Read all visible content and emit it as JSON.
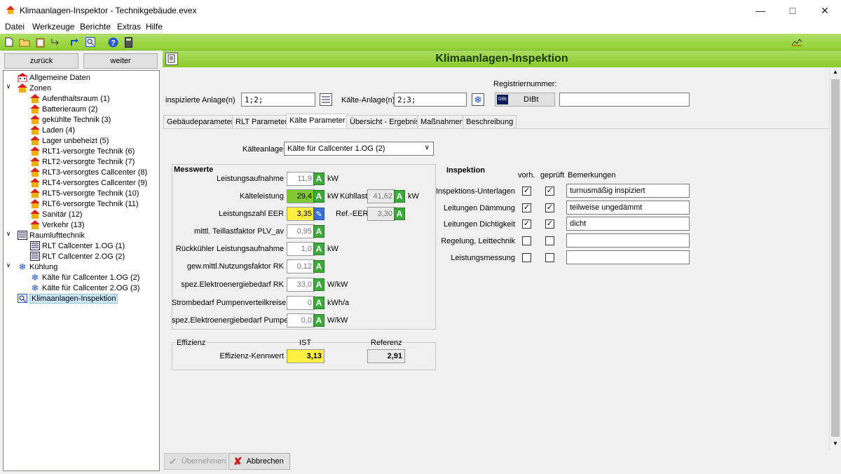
{
  "window": {
    "title": "Klimaanlagen-Inspektor - Technikgebäude.evex",
    "controls": [
      "minimize-icon",
      "maximize-icon",
      "close-icon"
    ]
  },
  "menu": [
    "Datei",
    "Werkzeuge",
    "Berichte",
    "Extras",
    "Hilfe"
  ],
  "toolbar": {
    "icons": [
      "new-file-icon",
      "open-folder-icon",
      "clipboard-icon",
      "import-icon",
      "export-icon",
      "search-icon",
      "help-icon",
      "calculator-icon"
    ],
    "chart_icon": "chart-icon"
  },
  "nav": {
    "back": "zurück",
    "forward": "weiter"
  },
  "tree": {
    "general": "Allgemeine Daten",
    "zones_label": "Zonen",
    "zones": [
      "Aufenthaltsraum (1)",
      "Batterieraum (2)",
      "gekühlte Technik (3)",
      "Laden (4)",
      "Lager unbeheizt (5)",
      "RLT1-versorgte Technik (6)",
      "RLT2-versorgte Technik (7)",
      "RLT3-versorgtes Callcenter (8)",
      "RLT4-versorgtes Callcenter (9)",
      "RLT5-versorgte Technik (10)",
      "RLT6-versorgte Technik (11)",
      "Sanitär (12)",
      "Verkehr (13)"
    ],
    "ventilation_label": "Raumlufttechnik",
    "ventilation": [
      "RLT Callcenter 1.OG (1)",
      "RLT Callcenter 2.OG (2)"
    ],
    "cooling_label": "Kühlung",
    "cooling": [
      "Kälte für Callcenter 1.OG (2)",
      "Kälte für Callcenter 2.OG (3)"
    ],
    "inspection": "Klimaanlagen-Inspektion"
  },
  "header": {
    "title": "Klimaanlagen-Inspektion"
  },
  "top": {
    "inspected_label": "inspizierte Anlage(n)",
    "inspected_value": "1;2;",
    "cooling_label": "Kälte-Anlage(n)",
    "cooling_value": "2;3;",
    "reg_label": "Registriernummer:",
    "dibt_label": "DIBt",
    "dibt_logo": "DIBt",
    "reg_value": ""
  },
  "tabs": [
    "Gebäudeparameter",
    "RLT Parameter",
    "Kälte Parameter",
    "Übersicht - Ergebnis",
    "Maßnahmen",
    "Beschreibung"
  ],
  "active_tab": "Kälte Parameter",
  "kaelteanlage": {
    "label": "Kälteanlage",
    "value": "Kälte für Callcenter 1.OG (2)"
  },
  "messwerte": {
    "title": "Messwerte",
    "rows": [
      {
        "label": "Leistungsaufnahme",
        "value": "11,9",
        "unit": "kW",
        "badge": "A",
        "style": ""
      },
      {
        "label": "Kälteleistung",
        "value": "29,4",
        "unit": "kW",
        "badge": "A",
        "style": "green"
      },
      {
        "label": "Leistungszahl EER",
        "value": "3,35",
        "unit": "",
        "badge": "edit",
        "style": "yellow"
      },
      {
        "label": "mittl. Teillastfaktor PLV_av",
        "value": "0,95",
        "unit": "",
        "badge": "A",
        "style": ""
      },
      {
        "label": "Rückkühler Leistungsaufnahme",
        "value": "1,0",
        "unit": "kW",
        "badge": "A",
        "style": ""
      },
      {
        "label": "gew.mittl.Nutzungsfaktor RK",
        "value": "0,12",
        "unit": "",
        "badge": "A",
        "style": ""
      },
      {
        "label": "spez.Elektroenergiebedarf RK",
        "value": "33,0",
        "unit": "W/kW",
        "badge": "A",
        "style": ""
      },
      {
        "label": "Strombedarf Pumpenverteilkreise",
        "value": "0",
        "unit": "kWh/a",
        "badge": "A",
        "style": ""
      },
      {
        "label": "spez.Elektroenergiebedarf Pumpen",
        "value": "0,0",
        "unit": "W/kW",
        "badge": "A",
        "style": ""
      }
    ],
    "kuehllast": {
      "label": "Kühllast",
      "value": "41,62",
      "unit": "kW",
      "badge": "A"
    },
    "ref_eer": {
      "label": "Ref.-EER",
      "value": "3,30",
      "badge": "A"
    },
    "badge_letter": "A",
    "edit_glyph": "✎"
  },
  "effizienz": {
    "title": "Effizienz",
    "ist_label": "IST",
    "ref_label": "Referenz",
    "row_label": "Effizienz-Kennwert",
    "ist_value": "3,13",
    "ref_value": "2,91"
  },
  "inspektion": {
    "title": "Inspektion",
    "col_vorh": "vorh.",
    "col_geprueft": "geprüft",
    "col_remarks": "Bemerkungen",
    "rows": [
      {
        "label": "Inspektions-Unterlagen",
        "vorh": true,
        "geprueft": true,
        "remark": "turnusmäßig inspiziert"
      },
      {
        "label": "Leitungen Dämmung",
        "vorh": true,
        "geprueft": true,
        "remark": "teilweise ungedämmt"
      },
      {
        "label": "Leitungen Dichtigkeit",
        "vorh": true,
        "geprueft": true,
        "remark": "dicht"
      },
      {
        "label": "Regelung, Leittechnik",
        "vorh": false,
        "geprueft": false,
        "remark": ""
      },
      {
        "label": "Leistungsmessung",
        "vorh": false,
        "geprueft": false,
        "remark": ""
      }
    ]
  },
  "buttons": {
    "apply": "Übernehmen",
    "cancel": "Abbrechen"
  },
  "colors": {
    "green_accent": "#8fcf2e",
    "value_green": "#7ec934",
    "value_yellow": "#ffee44",
    "badge_green": "#3da93d"
  }
}
